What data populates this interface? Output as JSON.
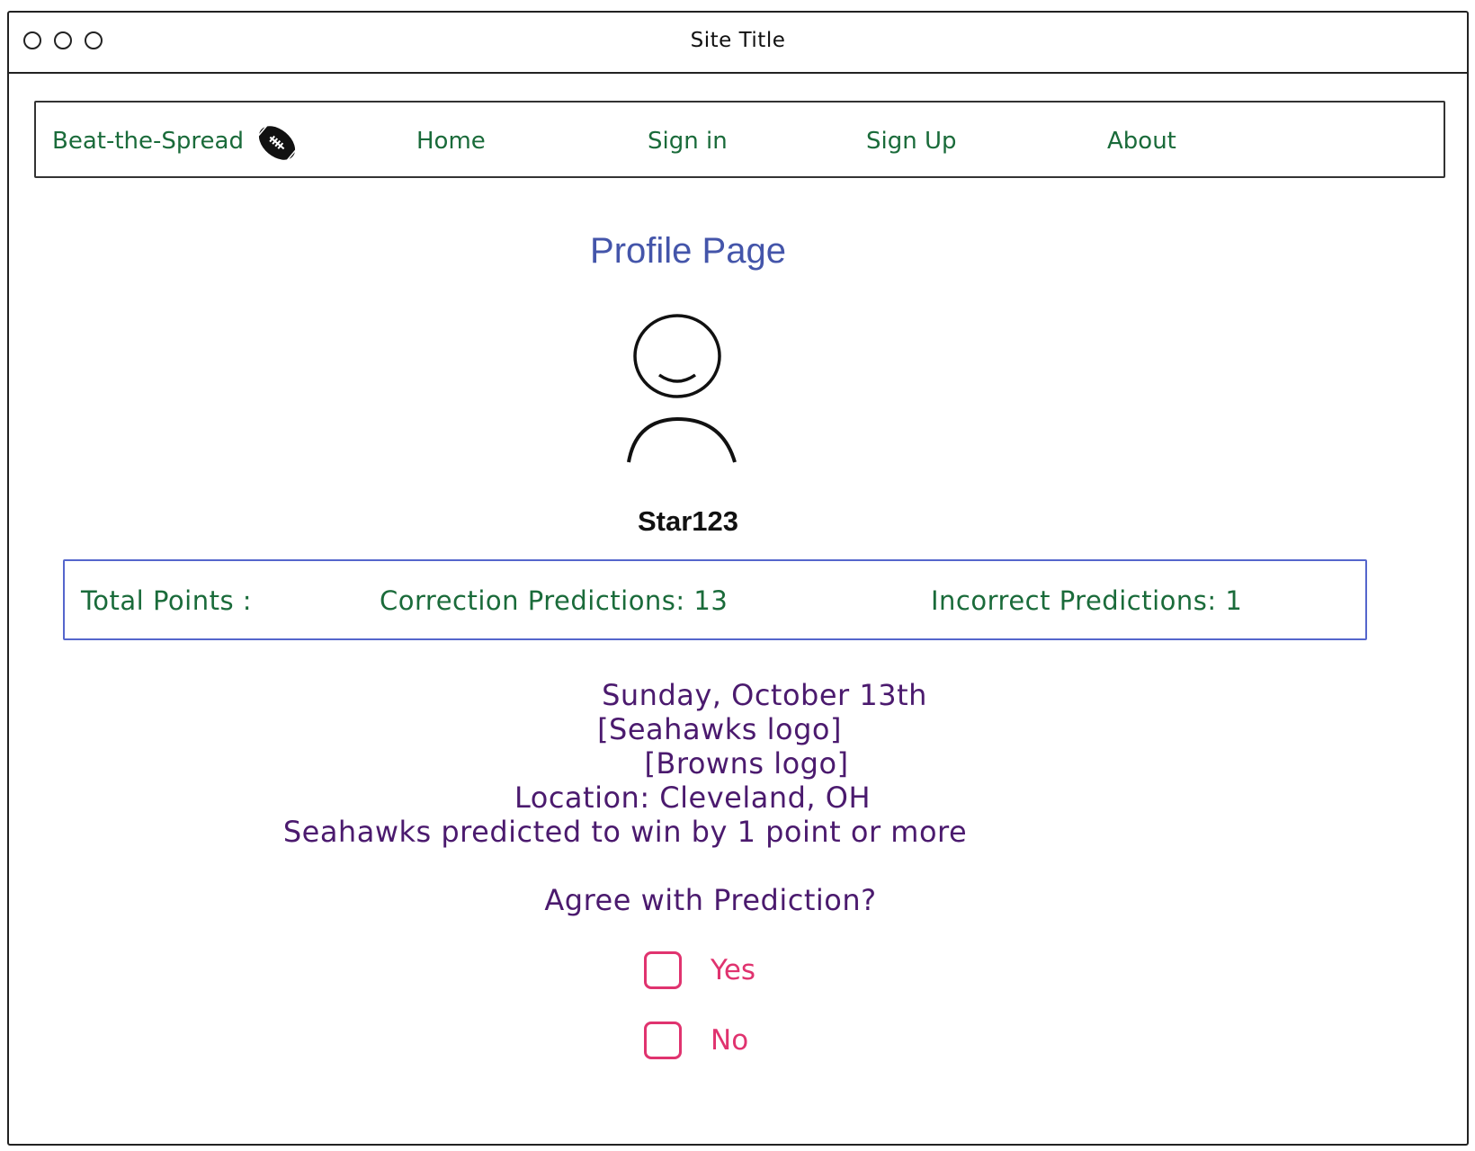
{
  "window": {
    "title": "Site Title"
  },
  "nav": {
    "brand": "Beat-the-Spread",
    "brand_icon": "football-icon",
    "items": [
      {
        "label": "Home"
      },
      {
        "label": "Sign in"
      },
      {
        "label": "Sign Up"
      },
      {
        "label": "About"
      }
    ]
  },
  "profile": {
    "title": "Profile Page",
    "avatar_icon": "user-avatar-icon",
    "username": "Star123"
  },
  "stats": {
    "total_points": "Total Points   :",
    "correct_predictions": "Correction Predictions: 13",
    "incorrect_predictions": "Incorrect Predictions: 1"
  },
  "game": {
    "date": "Sunday, October 13th",
    "team1_logo": "[Seahawks logo]",
    "team2_logo": "[Browns logo]",
    "location": "Location: Cleveland, OH",
    "prediction": "Seahawks predicted to win by 1 point or more"
  },
  "vote": {
    "question": "Agree with Prediction?",
    "options": [
      {
        "label": "Yes",
        "checked": false
      },
      {
        "label": "No",
        "checked": false
      }
    ]
  },
  "colors": {
    "nav_text": "#1a6b3a",
    "title": "#4455aa",
    "stats_border": "#5566cc",
    "game_text": "#4b1a6e",
    "option_accent": "#e0336f"
  }
}
